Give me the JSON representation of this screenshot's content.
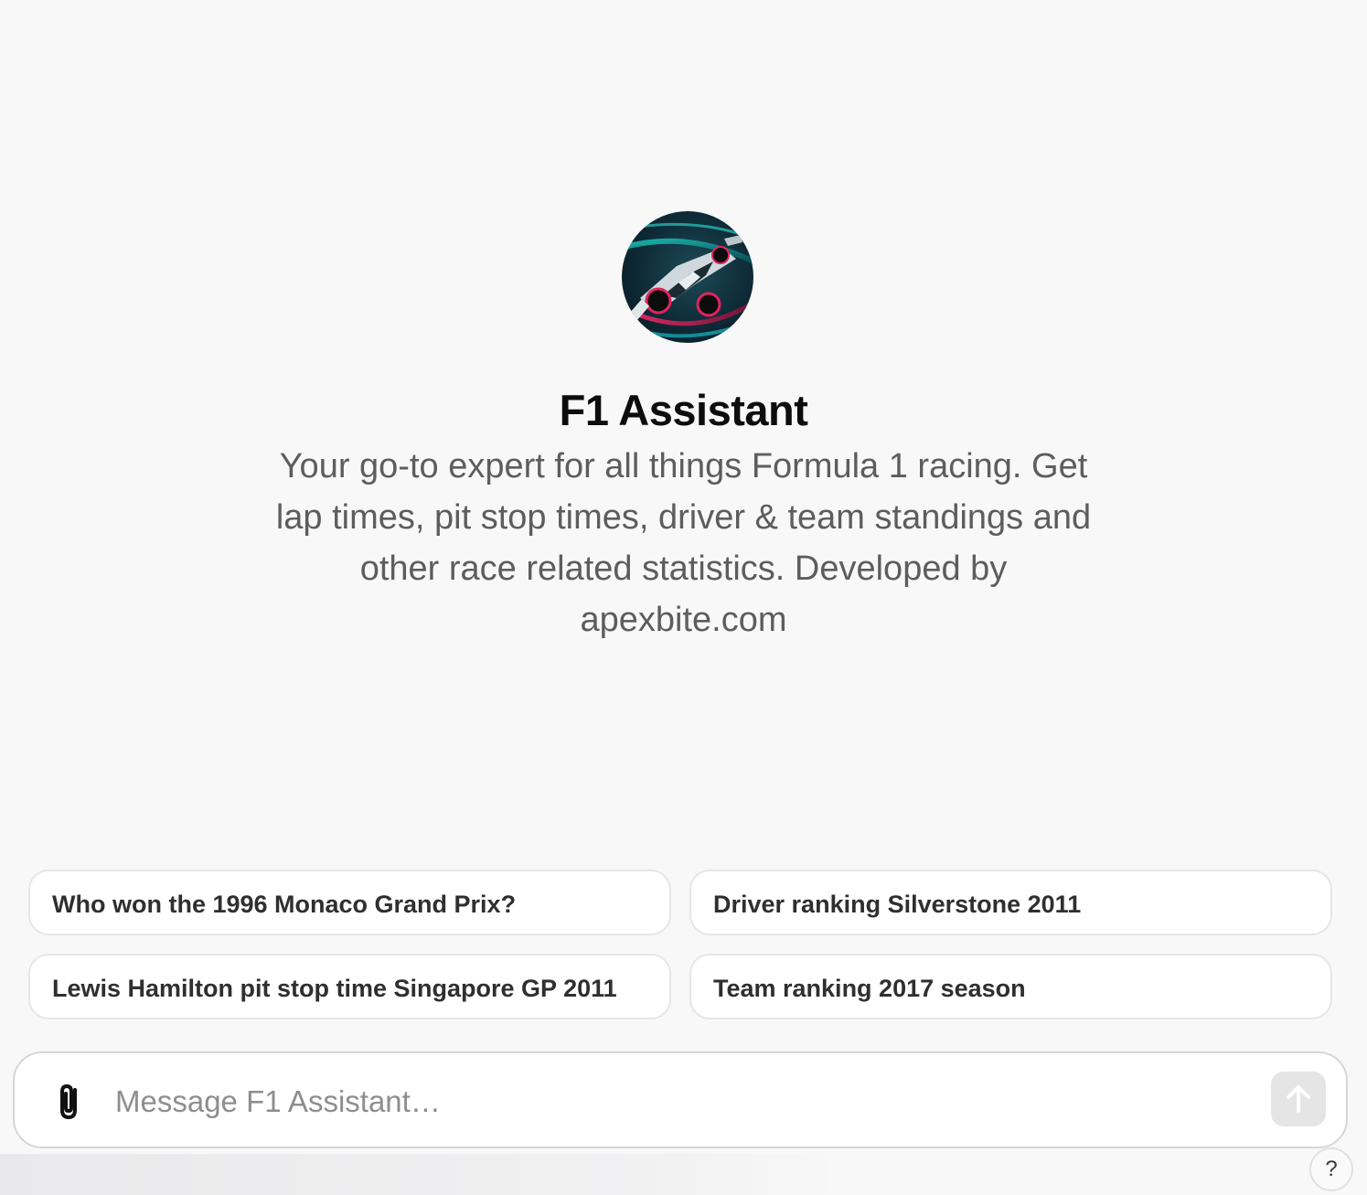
{
  "assistant": {
    "name": "F1 Assistant",
    "avatar_icon": "race-car-avatar",
    "description": "Your go-to expert for all things Formula 1 racing. Get lap times, pit stop times, driver & team standings and other race related statistics. Developed by apexbite.com"
  },
  "suggestions": [
    {
      "label": "Who won the 1996 Monaco Grand Prix?"
    },
    {
      "label": "Driver ranking Silverstone 2011"
    },
    {
      "label": "Lewis Hamilton pit stop time Singapore GP 2011"
    },
    {
      "label": "Team ranking 2017 season"
    }
  ],
  "composer": {
    "placeholder": "Message F1 Assistant…",
    "value": "",
    "attach_icon": "paperclip-icon",
    "send_icon": "arrow-up-icon"
  },
  "help": {
    "label": "?"
  },
  "colors": {
    "background": "#f8f8f9",
    "title": "#0d0d0d",
    "description": "#5d5d5d",
    "send_button_disabled": "#e5e5e6"
  }
}
